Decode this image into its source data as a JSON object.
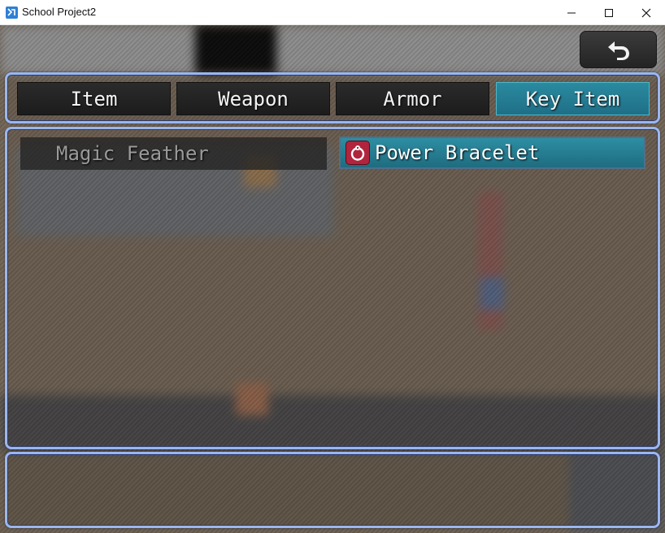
{
  "window": {
    "title": "School Project2"
  },
  "categories": [
    {
      "label": "Item",
      "selected": false
    },
    {
      "label": "Weapon",
      "selected": false
    },
    {
      "label": "Armor",
      "selected": false
    },
    {
      "label": "Key Item",
      "selected": true
    }
  ],
  "items": [
    {
      "name": "Magic Feather",
      "enabled": false,
      "icon": "none"
    },
    {
      "name": "Power Bracelet",
      "enabled": true,
      "selected": true,
      "icon": "bracelet-icon"
    }
  ],
  "help": {
    "text": ""
  },
  "colors": {
    "window_border": "#9ab6f0",
    "selection": "#2a8aa0",
    "icon_red": "#b0243e"
  }
}
